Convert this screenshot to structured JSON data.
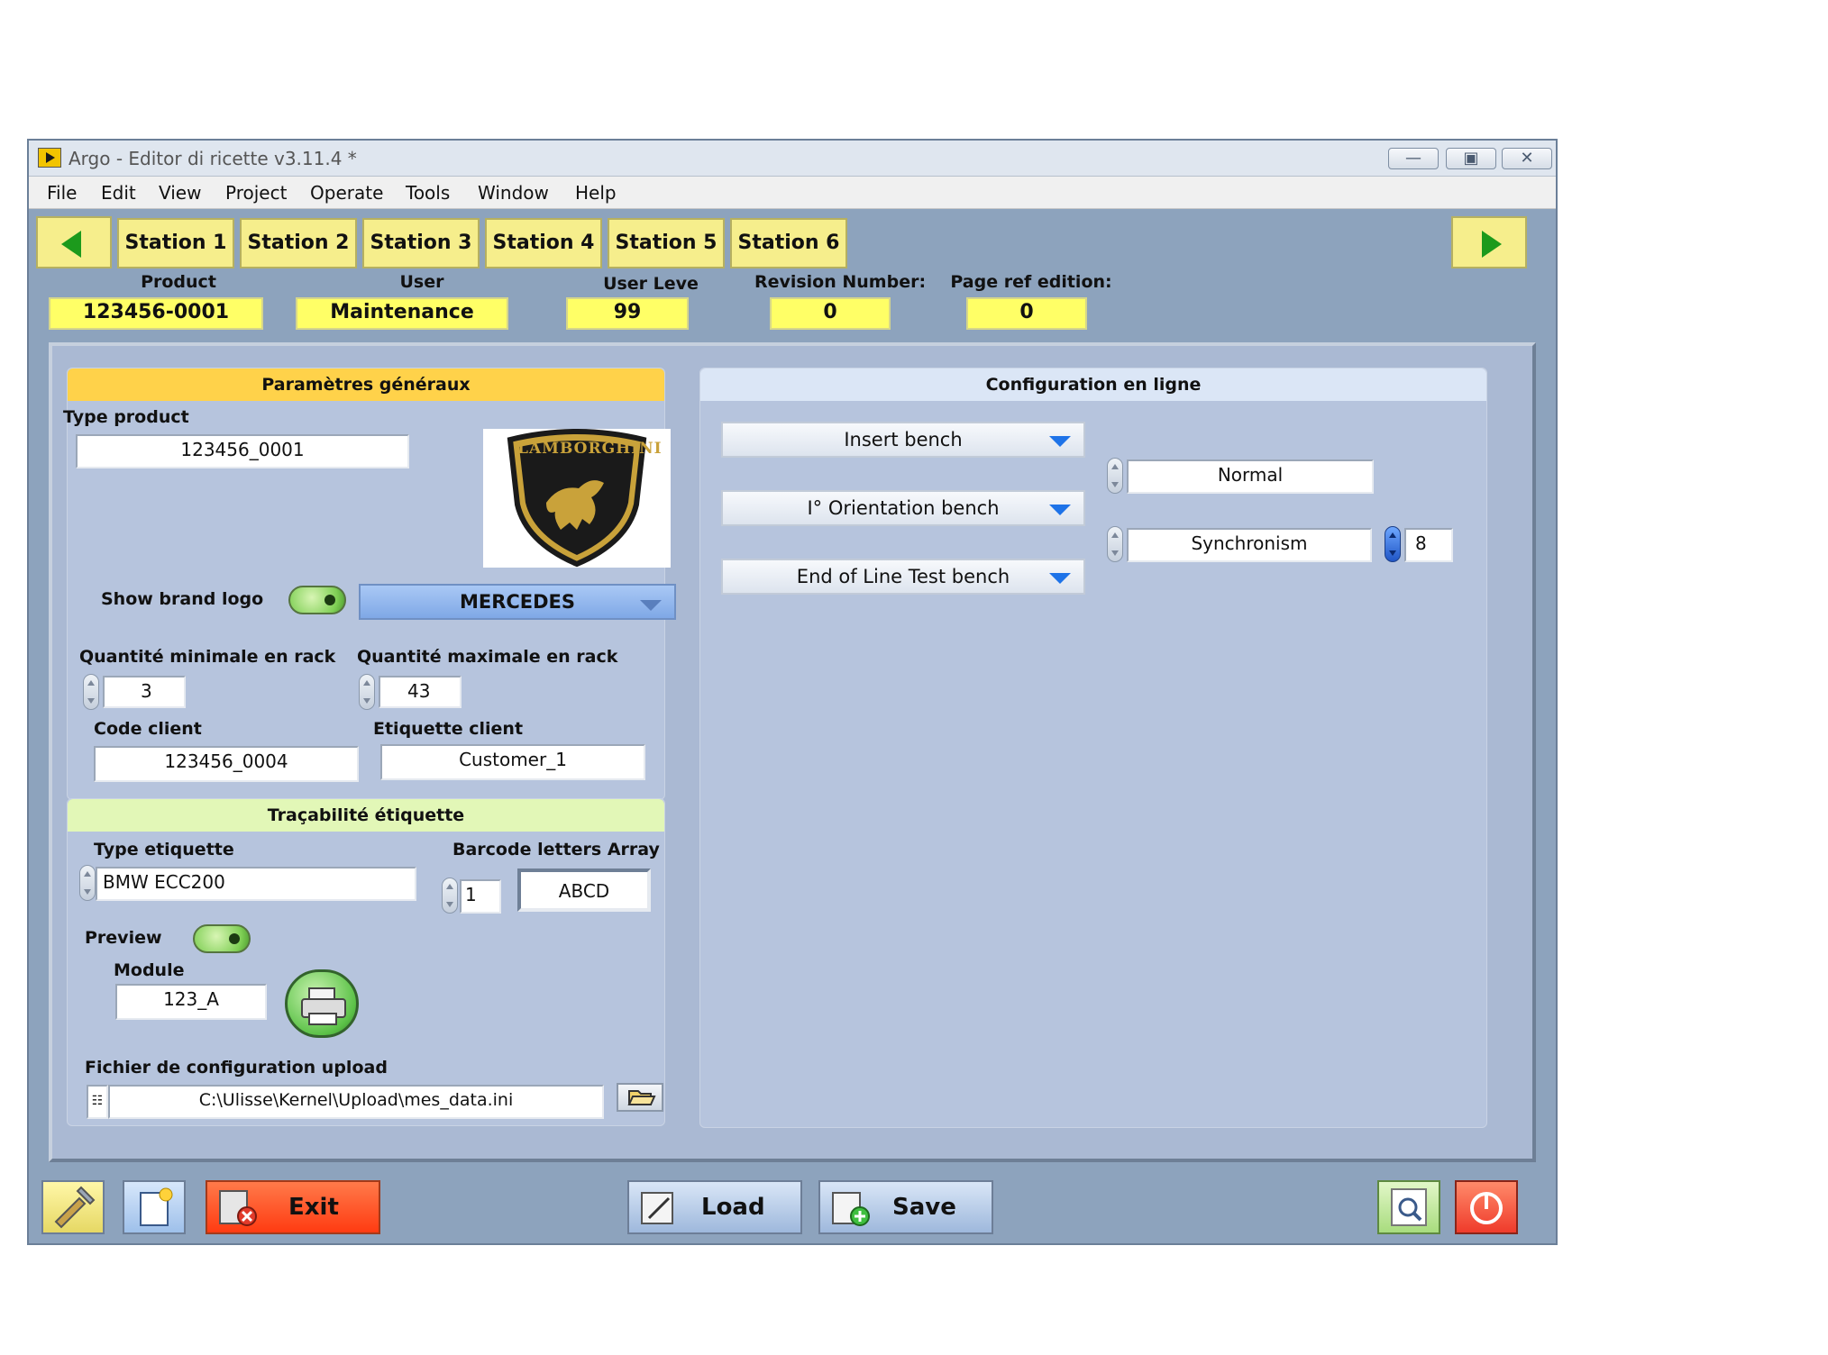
{
  "window": {
    "title": "Argo - Editor di ricette v3.11.4 *"
  },
  "menu": [
    "File",
    "Edit",
    "View",
    "Project",
    "Operate",
    "Tools",
    "Window",
    "Help"
  ],
  "tabs": [
    "Station 1",
    "Station 2",
    "Station 3",
    "Station 4",
    "Station 5",
    "Station 6"
  ],
  "info": {
    "product_label": "Product",
    "product_value": "123456-0001",
    "user_label": "User",
    "user_value": "Maintenance",
    "level_label": "User Leve",
    "level_value": "99",
    "revision_label": "Revision Number:",
    "revision_value": "0",
    "pageref_label": "Page ref edition:",
    "pageref_value": "0"
  },
  "general": {
    "header": "Paramètres généraux",
    "type_product_label": "Type product",
    "type_product_value": "123456_0001",
    "logo_text": "LAMBORGHINI",
    "show_logo_label": "Show brand logo",
    "brand_value": "MERCEDES",
    "qty_min_label": "Quantité minimale en rack",
    "qty_min_value": "3",
    "qty_max_label": "Quantité maximale en rack",
    "qty_max_value": "43",
    "code_client_label": "Code client",
    "code_client_value": "123456_0004",
    "etiquette_client_label": "Etiquette client",
    "etiquette_client_value": "Customer_1"
  },
  "trace": {
    "header": "Traçabilité étiquette",
    "type_label": "Type etiquette",
    "type_value": "BMW ECC200",
    "barcode_label": "Barcode letters Array",
    "barcode_index": "1",
    "barcode_value": "ABCD",
    "preview_label": "Preview",
    "module_label": "Module",
    "module_value": "123_A",
    "file_label": "Fichier de configuration upload",
    "file_value": "C:\\Ulisse\\Kernel\\Upload\\mes_data.ini"
  },
  "config": {
    "header": "Configuration en ligne",
    "bench1": "Insert bench",
    "bench2": "I° Orientation bench",
    "bench3": "End of Line Test bench",
    "mode1": "Normal",
    "mode2": "Synchronism",
    "sync_count": "8"
  },
  "buttons": {
    "exit": "Exit",
    "load": "Load",
    "save": "Save"
  },
  "colors": {
    "accent_yellow": "#ffff66",
    "panel_blue": "#b6c4dd",
    "exit_red": "#ff4a1a",
    "window_frame": "#8da3bd"
  }
}
